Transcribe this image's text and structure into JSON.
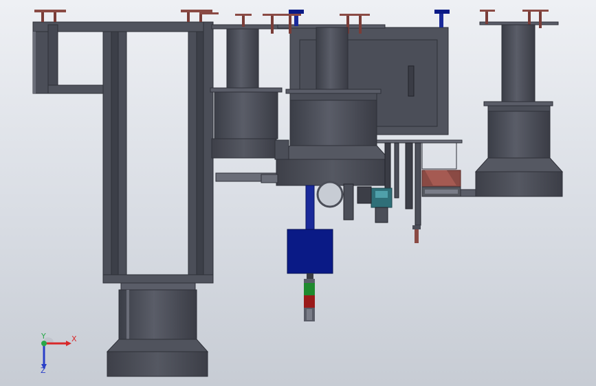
{
  "viewport": {
    "background_top": "#eef0f4",
    "background_bottom": "#c7ccd4"
  },
  "model": {
    "primary_color": "#4b4e58",
    "shade_color": "#5a5d68",
    "dark_color": "#2e3038",
    "accent_colors": {
      "motor_blue": "#0a1a86",
      "rod_blue": "#1a2a9a",
      "bracket_red": "#8a4a44",
      "signal_green": "#1f8a2e",
      "signal_red": "#9a1a1a",
      "panel_teal": "#2f6f78"
    }
  },
  "triad": {
    "x_label": "X",
    "y_label": "Y",
    "z_label": "Z",
    "x_color": "#d8282a",
    "y_color": "#2aa84a",
    "z_color": "#2a3fc8",
    "icon": "coordinate-triad-icon"
  }
}
